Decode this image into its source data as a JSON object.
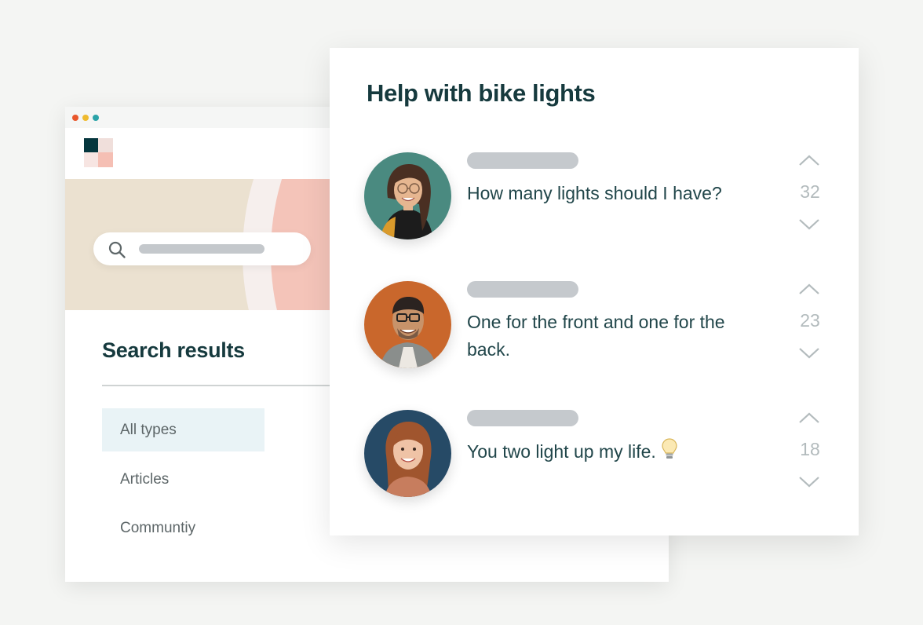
{
  "browser": {
    "window_controls": [
      "close",
      "minimize",
      "maximize"
    ],
    "search": {
      "icon": "search-icon"
    },
    "results_title": "Search results",
    "filters": [
      {
        "label": "All types",
        "active": true
      },
      {
        "label": "Articles",
        "active": false
      },
      {
        "label": "Communtiy",
        "active": false
      }
    ]
  },
  "card": {
    "title": "Help with bike lights",
    "posts": [
      {
        "text": "How many lights should I have?",
        "votes": "32",
        "avatar": "avatar-woman-glasses",
        "emoji": ""
      },
      {
        "text": "One for the front and one for the back.",
        "votes": "23",
        "avatar": "avatar-man-glasses",
        "emoji": ""
      },
      {
        "text": "You two light up my life.",
        "votes": "18",
        "avatar": "avatar-woman-smiling",
        "emoji": "lightbulb-icon"
      }
    ]
  },
  "colors": {
    "brand_dark": "#163a3e",
    "hero_beige": "#ebe1d0",
    "hero_pink": "#f4c4b9",
    "active_filter_bg": "#e9f3f6",
    "vote_gray": "#b3bbbd"
  }
}
